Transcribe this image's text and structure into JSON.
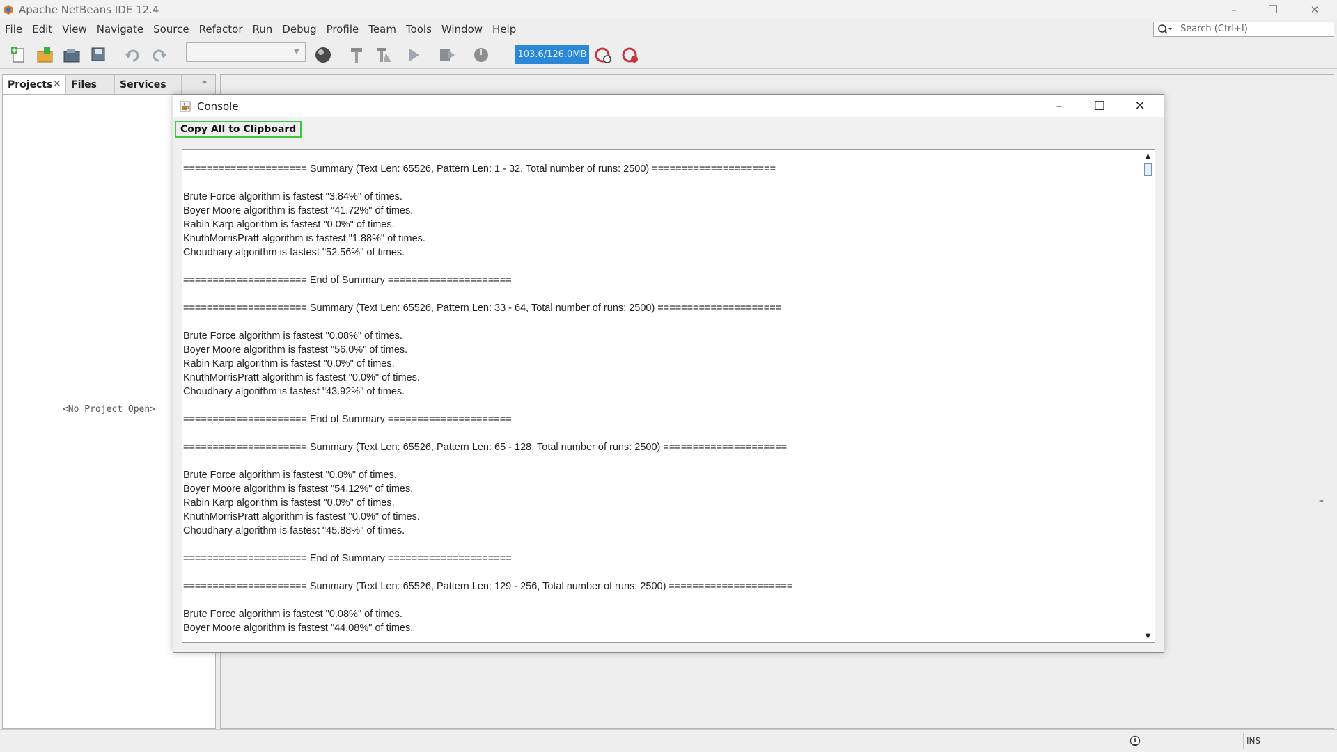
{
  "window": {
    "title": "Apache NetBeans IDE 12.4"
  },
  "menu": [
    "File",
    "Edit",
    "View",
    "Navigate",
    "Source",
    "Refactor",
    "Run",
    "Debug",
    "Profile",
    "Team",
    "Tools",
    "Window",
    "Help"
  ],
  "search": {
    "placeholder": "Search (Ctrl+I)"
  },
  "toolbar": {
    "memory": "103.6/126.0MB",
    "icons": [
      "new-file-icon",
      "new-project-icon",
      "open-project-icon",
      "save-all-icon",
      "undo-icon",
      "redo-icon",
      "config-combo",
      "browser-globe-icon",
      "build-hammer-icon",
      "clean-build-icon",
      "run-icon",
      "debug-icon",
      "profile-icon",
      "gc-icon",
      "profiler-icon"
    ]
  },
  "projects_panel": {
    "tabs": [
      "Projects",
      "Files",
      "Services"
    ],
    "close_glyph": "✕",
    "minimize_glyph": "–",
    "empty_text": "<No Project Open>"
  },
  "status": {
    "ins": "INS"
  },
  "console": {
    "title": "Console",
    "copy_button": "Copy All to Clipboard",
    "lines": [
      "===================== Summary (Text Len: 65526, Pattern Len: 1 - 32, Total number of runs: 2500) =====================",
      "",
      "Brute Force algorithm is fastest \"3.84%\" of times.",
      "Boyer Moore algorithm is fastest \"41.72%\" of times.",
      "Rabin Karp algorithm is fastest \"0.0%\" of times.",
      "KnuthMorrisPratt algorithm is fastest \"1.88%\" of times.",
      "Choudhary algorithm is fastest \"52.56%\" of times.",
      "",
      "===================== End of Summary =====================",
      "",
      "===================== Summary (Text Len: 65526, Pattern Len: 33 - 64, Total number of runs: 2500) =====================",
      "",
      "Brute Force algorithm is fastest \"0.08%\" of times.",
      "Boyer Moore algorithm is fastest \"56.0%\" of times.",
      "Rabin Karp algorithm is fastest \"0.0%\" of times.",
      "KnuthMorrisPratt algorithm is fastest \"0.0%\" of times.",
      "Choudhary algorithm is fastest \"43.92%\" of times.",
      "",
      "===================== End of Summary =====================",
      "",
      "===================== Summary (Text Len: 65526, Pattern Len: 65 - 128, Total number of runs: 2500) =====================",
      "",
      "Brute Force algorithm is fastest \"0.0%\" of times.",
      "Boyer Moore algorithm is fastest \"54.12%\" of times.",
      "Rabin Karp algorithm is fastest \"0.0%\" of times.",
      "KnuthMorrisPratt algorithm is fastest \"0.0%\" of times.",
      "Choudhary algorithm is fastest \"45.88%\" of times.",
      "",
      "===================== End of Summary =====================",
      "",
      "===================== Summary (Text Len: 65526, Pattern Len: 129 - 256, Total number of runs: 2500) =====================",
      "",
      "Brute Force algorithm is fastest \"0.08%\" of times.",
      "Boyer Moore algorithm is fastest \"44.08%\" of times."
    ]
  }
}
